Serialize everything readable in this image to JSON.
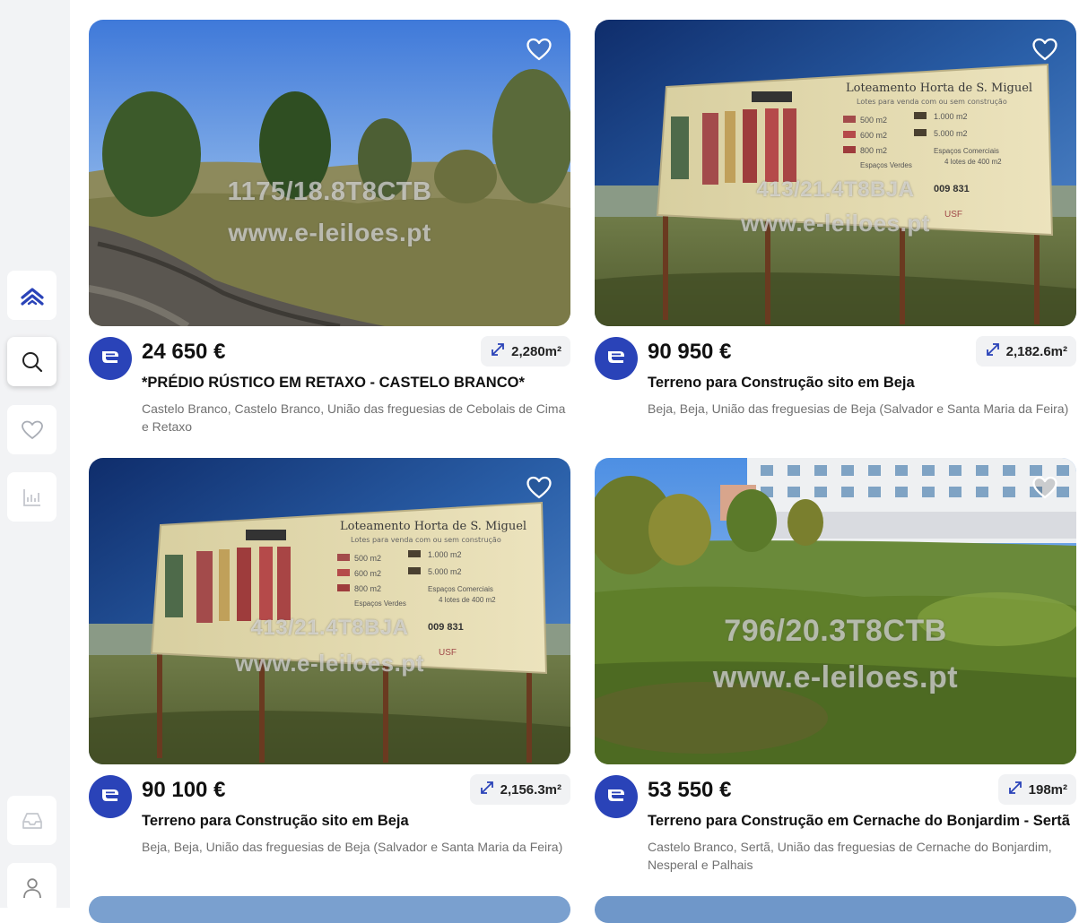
{
  "sidebar": {
    "items": [
      {
        "name": "home",
        "icon": "chevron-up-double-icon"
      },
      {
        "name": "search",
        "icon": "search-icon"
      },
      {
        "name": "favorites",
        "icon": "heart-icon"
      },
      {
        "name": "charts",
        "icon": "chart-icon"
      },
      {
        "name": "inbox",
        "icon": "inbox-icon"
      },
      {
        "name": "profile",
        "icon": "user-icon"
      }
    ]
  },
  "listings": [
    {
      "price": "24 650 €",
      "area": "2,280m²",
      "title": "*PRÉDIO RÚSTICO EM RETAXO - CASTELO BRANCO*",
      "location": "Castelo Branco, Castelo Branco, União das freguesias de Cebolais de Cima e Retaxo",
      "watermark_ref": "1175/18.8T8CTB",
      "watermark_url": "www.e-leiloes.pt"
    },
    {
      "price": "90 950 €",
      "area": "2,182.6m²",
      "title": "Terreno para Construção sito em Beja",
      "location": "Beja, Beja, União das freguesias de Beja (Salvador e Santa Maria da Feira)",
      "watermark_ref": "413/21.4T8BJA",
      "watermark_url": "www.e-leiloes.pt"
    },
    {
      "price": "90 100 €",
      "area": "2,156.3m²",
      "title": "Terreno para Construção sito em Beja",
      "location": "Beja, Beja, União das freguesias de Beja (Salvador e Santa Maria da Feira)",
      "watermark_ref": "413/21.4T8BJA",
      "watermark_url": "www.e-leiloes.pt"
    },
    {
      "price": "53 550 €",
      "area": "198m²",
      "title": "Terreno para Construção em Cernache do Bonjardim - Sertã",
      "location": "Castelo Branco, Sertã, União das freguesias de Cernache do Bonjardim, Nesperal e Palhais",
      "watermark_ref": "796/20.3T8CTB",
      "watermark_url": "www.e-leiloes.pt"
    }
  ],
  "billboard": {
    "heading": "Loteamento Horta de S. Miguel",
    "subheading": "Lotes para venda com ou sem construção",
    "legend": [
      "500 m2",
      "600 m2",
      "800 m2",
      "Espaços Verdes",
      "1.000 m2",
      "5.000 m2",
      "Espaços Comerciais",
      "4 lotes de 400 m2"
    ],
    "phone": "009 831",
    "brand": "USF"
  },
  "colors": {
    "brand_blue": "#2a43b8",
    "sidebar_bg": "#f2f3f5",
    "chip_bg": "#f1f2f4",
    "muted_text": "#707070"
  }
}
